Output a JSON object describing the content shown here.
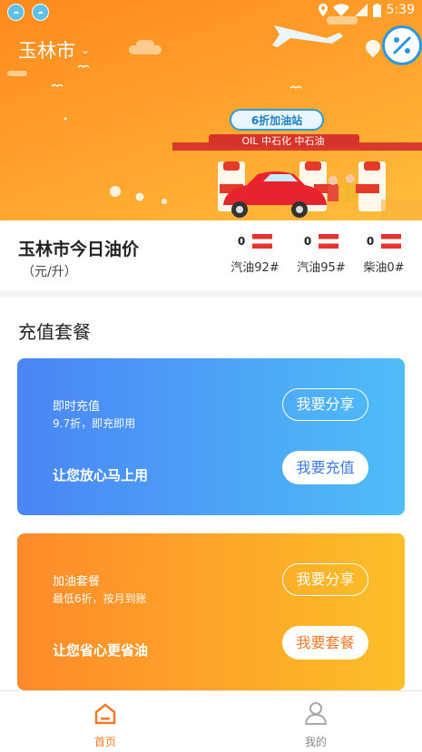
{
  "status_bar": {
    "time": "5:39"
  },
  "header": {
    "city": "玉林市",
    "banner": {
      "sign_text": "6折加油站",
      "brand_text": "OIL 中石化 中石油"
    }
  },
  "oil_prices": {
    "title": "玉林市今日油价",
    "unit": "（元/升）",
    "items": [
      {
        "value": "0",
        "name": "汽油92#"
      },
      {
        "value": "0",
        "name": "汽油95#"
      },
      {
        "value": "0",
        "name": "柴油0#"
      }
    ]
  },
  "recharge": {
    "title": "充值套餐",
    "cards": [
      {
        "title": "即时充值",
        "subtitle": "9.7折，即充即用",
        "slogan": "让您放心马上用",
        "share_label": "我要分享",
        "action_label": "我要充值"
      },
      {
        "title": "加油套餐",
        "subtitle": "最低6折，按月到账",
        "slogan": "让您省心更省油",
        "share_label": "我要分享",
        "action_label": "我要套餐"
      }
    ]
  },
  "tabbar": {
    "items": [
      {
        "label": "首页"
      },
      {
        "label": "我的"
      }
    ]
  },
  "colors": {
    "accent": "#f27b26",
    "blue_card": "#4a85f5",
    "orange_card": "#ff8a2a"
  }
}
